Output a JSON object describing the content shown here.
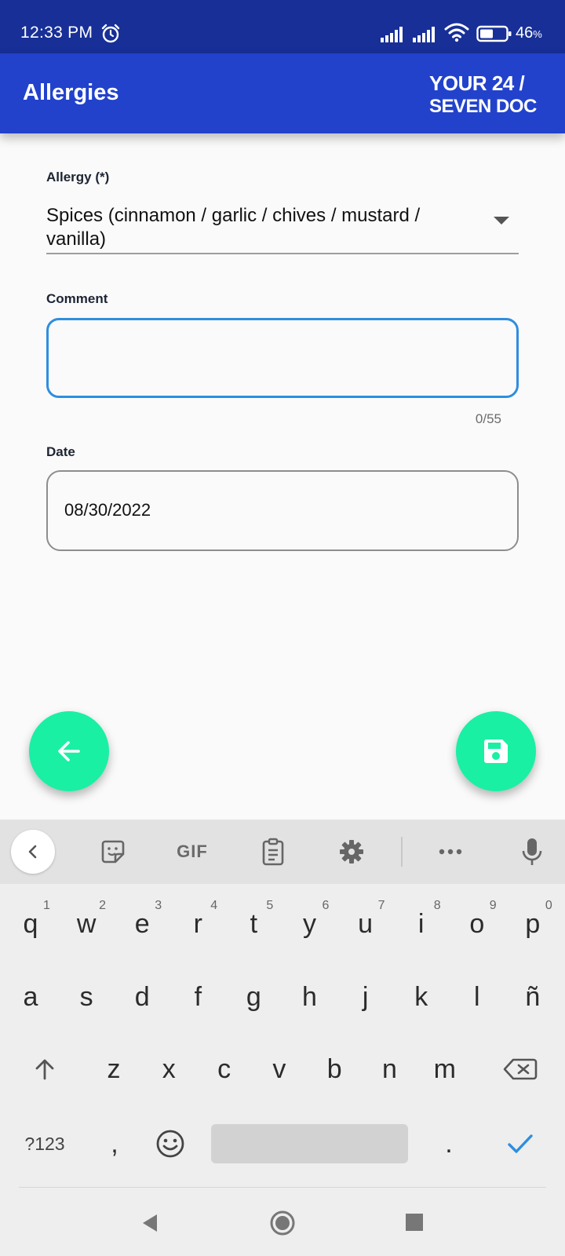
{
  "status_bar": {
    "time": "12:33 PM",
    "battery": "46",
    "battery_unit": "%",
    "icons": [
      "alarm-icon",
      "signal-icon",
      "signal-icon",
      "wifi-icon",
      "battery-icon"
    ]
  },
  "app_bar": {
    "title": "Allergies",
    "logo_line1": "YOUR 24 /",
    "logo_line2": "SEVEN DOC"
  },
  "form": {
    "allergy_label": "Allergy (*)",
    "allergy_value": "Spices (cinnamon / garlic / chives / mustard / vanilla)",
    "comment_label": "Comment",
    "comment_value": "",
    "comment_counter": "0/55",
    "date_label": "Date",
    "date_value": "08/30/2022"
  },
  "fabs": {
    "back_icon": "arrow-left-icon",
    "save_icon": "save-icon"
  },
  "keyboard": {
    "toolbar": [
      "back-chevron-icon",
      "sticker-icon",
      "GIF",
      "clipboard-icon",
      "gear-icon",
      "more-icon",
      "mic-icon"
    ],
    "gif_label": "GIF",
    "row1": [
      "q",
      "w",
      "e",
      "r",
      "t",
      "y",
      "u",
      "i",
      "o",
      "p"
    ],
    "row1_hints": [
      "1",
      "2",
      "3",
      "4",
      "5",
      "6",
      "7",
      "8",
      "9",
      "0"
    ],
    "row2": [
      "a",
      "s",
      "d",
      "f",
      "g",
      "h",
      "j",
      "k",
      "l",
      "ñ"
    ],
    "row3": [
      "z",
      "x",
      "c",
      "v",
      "b",
      "n",
      "m"
    ],
    "symbols_key": "?123",
    "comma_key": ",",
    "period_key": "."
  },
  "colors": {
    "status_bar": "#172f96",
    "app_bar": "#2242cc",
    "fab": "#19f0a4",
    "input_focus": "#2e8ee0"
  }
}
